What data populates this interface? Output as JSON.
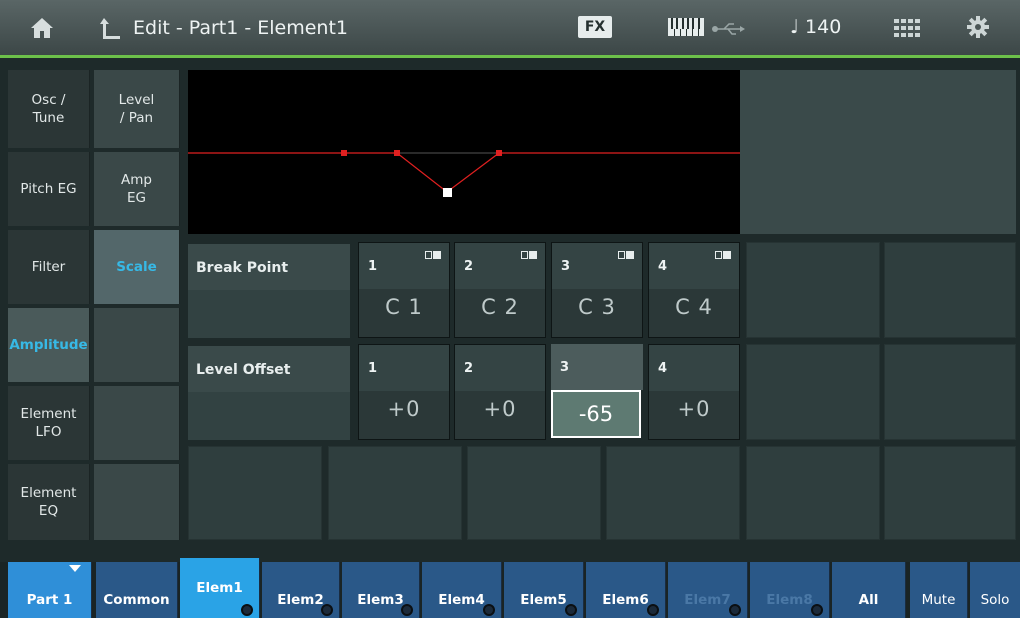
{
  "header": {
    "title": "Edit - Part1 - Element1",
    "fx_label": "FX",
    "tempo_symbol": "♩",
    "tempo": "140"
  },
  "nav": {
    "col1": [
      "Osc /\nTune",
      "Pitch EG",
      "Filter",
      "Amplitude",
      "Element\nLFO",
      "Element\nEQ"
    ],
    "col2": [
      "Level\n/ Pan",
      "Amp\nEG",
      "Scale",
      "",
      "",
      ""
    ],
    "active_group": "Amplitude",
    "active_item": "Scale"
  },
  "break_point": {
    "label": "Break Point",
    "cells": [
      {
        "num": "1",
        "value": "C 1"
      },
      {
        "num": "2",
        "value": "C 2"
      },
      {
        "num": "3",
        "value": "C 3"
      },
      {
        "num": "4",
        "value": "C 4"
      }
    ]
  },
  "level_offset": {
    "label": "Level Offset",
    "cells": [
      {
        "num": "1",
        "value": "+0"
      },
      {
        "num": "2",
        "value": "+0"
      },
      {
        "num": "3",
        "value": "-65"
      },
      {
        "num": "4",
        "value": "+0"
      }
    ],
    "selected_index": 2
  },
  "bottom": {
    "part": "Part 1",
    "tabs": [
      "Common",
      "Elem1",
      "Elem2",
      "Elem3",
      "Elem4",
      "Elem5",
      "Elem6",
      "Elem7",
      "Elem8",
      "All",
      "Mute",
      "Solo"
    ],
    "selected_tab": "Elem1",
    "disabled_tabs": [
      "Elem7",
      "Elem8"
    ]
  },
  "colors": {
    "accent_green": "#6cc04a",
    "accent_blue": "#37b9e6",
    "graph_line": "#e02020",
    "tab_blue": "#2a5888"
  },
  "icons": [
    "home-icon",
    "back-icon",
    "keyboard-icon",
    "usb-icon",
    "grid-icon",
    "gear-icon",
    "toggle-icon"
  ]
}
